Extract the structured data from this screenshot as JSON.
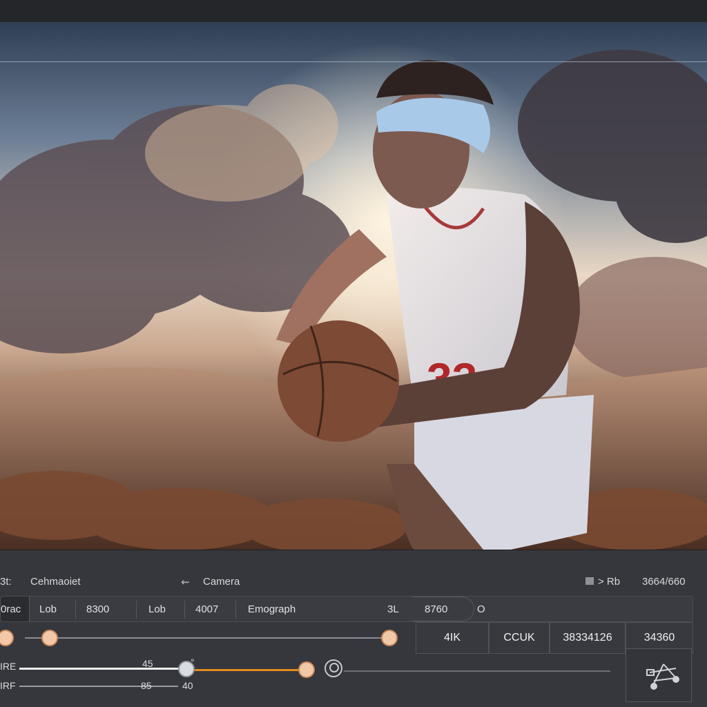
{
  "colors": {
    "accent": "#e58d1f",
    "panel": "#35373c",
    "knob": "#f2c8a8"
  },
  "viewport": {
    "content": "basketball player holding ball #33 against sunset clouds",
    "jersey_number": "33"
  },
  "header": {
    "left_prefix": "3t:",
    "left_title": "Cehmaoiet",
    "camera_icon": "camera-arrow-icon",
    "camera_label": "Camera",
    "right_icon": "square-icon",
    "right_arrow": "> Rb",
    "resolution": "3664/660"
  },
  "toolbar": {
    "tab_active": "0rac",
    "cells": [
      "Lob",
      "8300",
      "Lob",
      "4007",
      "Emograph",
      "3L",
      "8760"
    ],
    "end_glyph": "O"
  },
  "stats": [
    "4IK",
    "CCUK",
    "38334126",
    "34360"
  ],
  "sliders": {
    "row1_left_knob": "orange",
    "row1_values": {
      "start": 0.07,
      "end": 0.55
    },
    "row2_label_a": "IRE",
    "row2_value_a": "45",
    "row2_label_b": "IRF",
    "row2_value_b": "85",
    "row2_value_c": "40",
    "degree_mark": "°"
  }
}
